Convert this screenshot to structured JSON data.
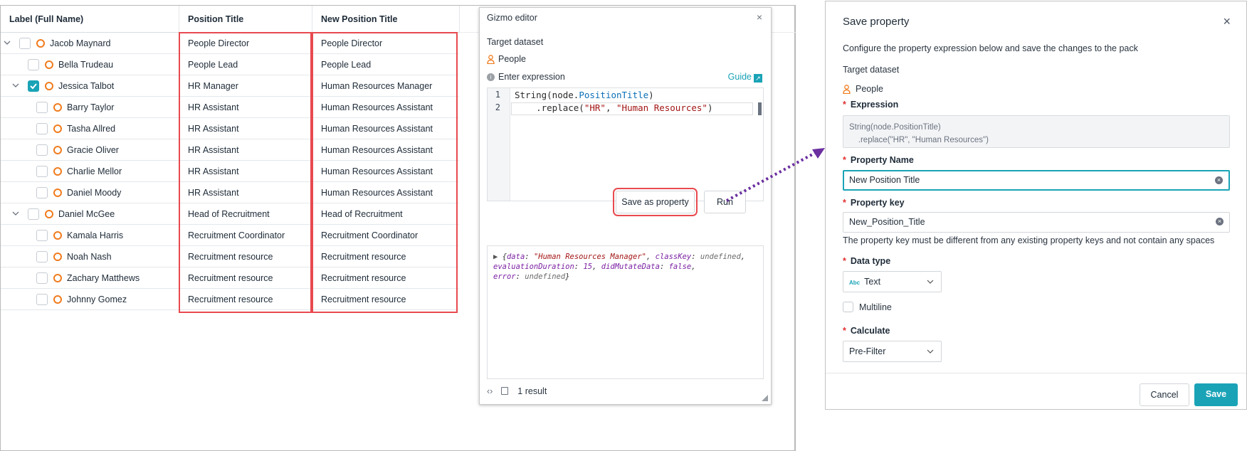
{
  "grid": {
    "headers": [
      "Label (Full Name)",
      "Position Title",
      "New Position Title"
    ],
    "rows": [
      {
        "name": "Jacob Maynard",
        "position": "People Director",
        "new_position": "People Director"
      },
      {
        "name": "Bella Trudeau",
        "position": "People Lead",
        "new_position": "People Lead"
      },
      {
        "name": "Jessica Talbot",
        "position": "HR Manager",
        "new_position": "Human Resources Manager",
        "checked": true
      },
      {
        "name": "Barry Taylor",
        "position": "HR Assistant",
        "new_position": "Human Resources Assistant"
      },
      {
        "name": "Tasha Allred",
        "position": "HR Assistant",
        "new_position": "Human Resources Assistant"
      },
      {
        "name": "Gracie Oliver",
        "position": "HR Assistant",
        "new_position": "Human Resources Assistant"
      },
      {
        "name": "Charlie Mellor",
        "position": "HR Assistant",
        "new_position": "Human Resources Assistant"
      },
      {
        "name": "Daniel Moody",
        "position": "HR Assistant",
        "new_position": "Human Resources Assistant"
      },
      {
        "name": "Daniel McGee",
        "position": "Head of Recruitment",
        "new_position": "Head of Recruitment"
      },
      {
        "name": "Kamala Harris",
        "position": "Recruitment Coordinator",
        "new_position": "Recruitment Coordinator"
      },
      {
        "name": "Noah Nash",
        "position": "Recruitment resource",
        "new_position": "Recruitment resource"
      },
      {
        "name": "Zachary Matthews",
        "position": "Recruitment resource",
        "new_position": "Recruitment resource"
      },
      {
        "name": "Johnny Gomez",
        "position": "Recruitment resource",
        "new_position": "Recruitment resource"
      }
    ]
  },
  "gizmo": {
    "title": "Gizmo editor",
    "close": "×",
    "target_label": "Target dataset",
    "dataset": "People",
    "expr_label": "Enter expression",
    "guide": "Guide",
    "code": {
      "l1_a": "String(node.",
      "l1_b": "PositionTitle",
      "l1_c": ")",
      "l2_a": "    .replace(",
      "l2_b": "\"HR\"",
      "l2_c": ", ",
      "l2_d": "\"Human Resources\"",
      "l2_e": ")"
    },
    "save_as_property": "Save as property",
    "run": "Run",
    "result": {
      "k_data": "data",
      "v_data": "\"Human Resources Manager\"",
      "k_class": "classKey",
      "v_class": "undefined",
      "k_eval": "evaluationDuration",
      "v_eval": "15",
      "k_mut": "didMutateData",
      "v_mut": "false",
      "k_err": "error",
      "v_err": "undefined"
    },
    "footer_count": "1 result"
  },
  "save_property": {
    "title": "Save property",
    "close": "×",
    "intro": "Configure the property expression below and save the changes to the pack",
    "target_label": "Target dataset",
    "dataset": "People",
    "expression_label": "Expression",
    "expression_value": "String(node.PositionTitle)\n    .replace(\"HR\", \"Human Resources\")",
    "property_name_label": "Property Name",
    "property_name_value": "New Position Title",
    "property_key_label": "Property key",
    "property_key_value": "New_Position_Title",
    "key_hint": "The property key must be different from any existing property keys and not contain any spaces",
    "data_type_label": "Data type",
    "data_type_prefix": "Abc",
    "data_type_value": "Text",
    "multiline_label": "Multiline",
    "calculate_label": "Calculate",
    "calculate_value": "Pre-Filter",
    "cancel": "Cancel",
    "save": "Save"
  },
  "colors": {
    "accent": "#1aa3b7",
    "highlight": "#e84a4f",
    "node": "#f07c1e",
    "arrow": "#6b2fa0"
  }
}
